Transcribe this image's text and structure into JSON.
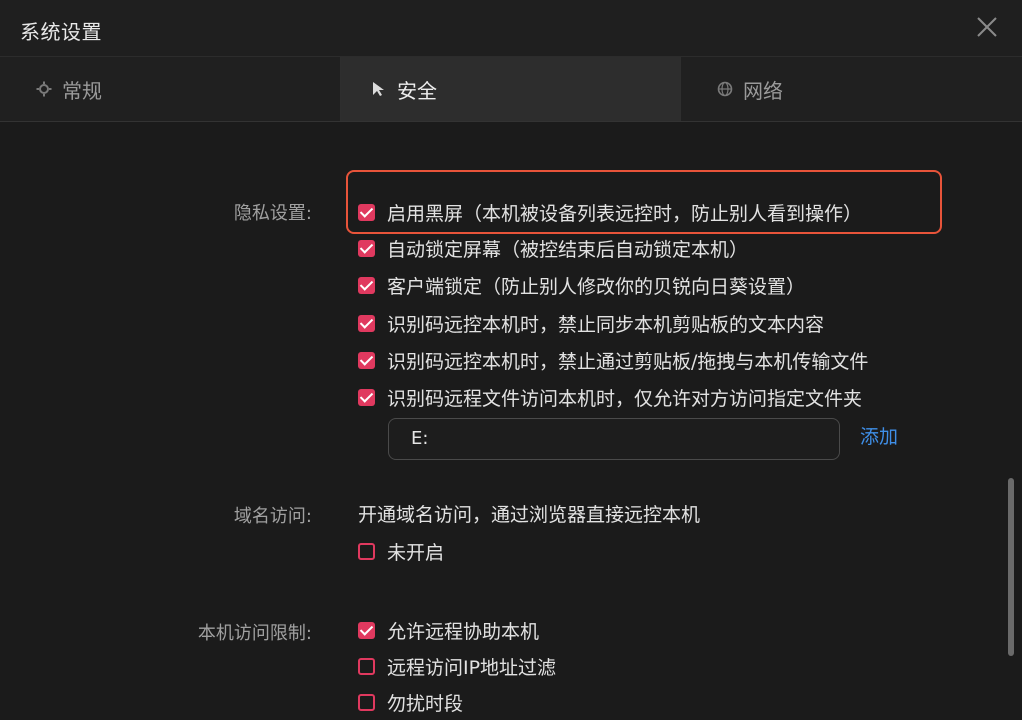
{
  "window": {
    "title": "系统设置"
  },
  "tabs": [
    {
      "label": "常规",
      "icon": "gear-icon"
    },
    {
      "label": "安全",
      "icon": "cursor-icon"
    },
    {
      "label": "网络",
      "icon": "globe-icon"
    }
  ],
  "privacy": {
    "label": "隐私设置:",
    "options": [
      {
        "text": "启用黑屏（本机被设备列表远控时，防止别人看到操作）",
        "checked": true
      },
      {
        "text": "自动锁定屏幕（被控结束后自动锁定本机）",
        "checked": true
      },
      {
        "text": "客户端锁定（防止别人修改你的贝锐向日葵设置）",
        "checked": true
      },
      {
        "text": "识别码远控本机时，禁止同步本机剪贴板的文本内容",
        "checked": true
      },
      {
        "text": "识别码远控本机时，禁止通过剪贴板/拖拽与本机传输文件",
        "checked": true
      },
      {
        "text": "识别码远程文件访问本机时，仅允许对方访问指定文件夹",
        "checked": true
      }
    ],
    "folder_value": "E:",
    "add_label": "添加"
  },
  "domain": {
    "label": "域名访问:",
    "description": "开通域名访问，通过浏览器直接远控本机",
    "option": {
      "text": "未开启",
      "checked": false
    }
  },
  "access": {
    "label": "本机访问限制:",
    "options": [
      {
        "text": "允许远程协助本机",
        "checked": true
      },
      {
        "text": "远程访问IP地址过滤",
        "checked": false
      },
      {
        "text": "勿扰时段",
        "checked": false
      }
    ]
  },
  "colors": {
    "accent": "#e0395f",
    "highlight": "#e8543a",
    "link": "#3f8fe8"
  }
}
